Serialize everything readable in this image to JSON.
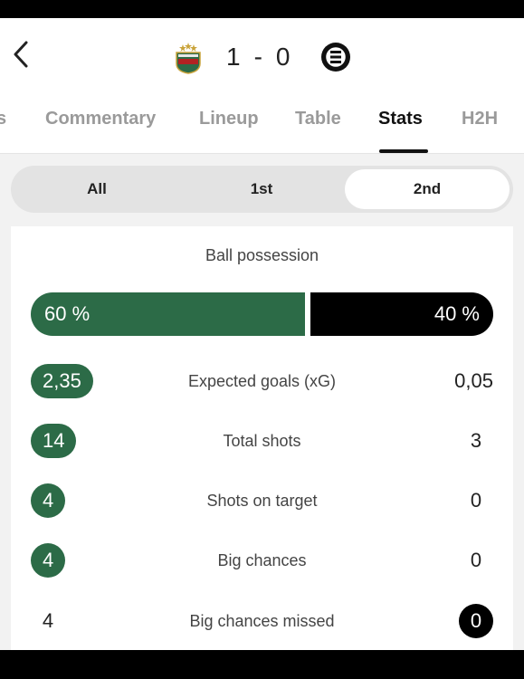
{
  "match": {
    "home_score": "1",
    "separator": "-",
    "away_score": "0"
  },
  "tabs": [
    {
      "label": "s"
    },
    {
      "label": "Commentary"
    },
    {
      "label": "Lineup"
    },
    {
      "label": "Table"
    },
    {
      "label": "Stats"
    },
    {
      "label": "H2H"
    }
  ],
  "active_tab": "Stats",
  "periods": [
    {
      "label": "All"
    },
    {
      "label": "1st"
    },
    {
      "label": "2nd"
    }
  ],
  "active_period": "2nd",
  "possession": {
    "title": "Ball possession",
    "home_label": "60 %",
    "away_label": "40 %",
    "home_percent": 60,
    "away_percent": 40
  },
  "stats": [
    {
      "label": "Expected goals (xG)",
      "home": "2,35",
      "away": "0,05",
      "highlight": "home"
    },
    {
      "label": "Total shots",
      "home": "14",
      "away": "3",
      "highlight": "home"
    },
    {
      "label": "Shots on target",
      "home": "4",
      "away": "0",
      "highlight": "home"
    },
    {
      "label": "Big chances",
      "home": "4",
      "away": "0",
      "highlight": "home"
    },
    {
      "label": "Big chances missed",
      "home": "4",
      "away": "0",
      "highlight": "away"
    }
  ],
  "colors": {
    "home_team": "#2c6b47",
    "away_team": "#000000",
    "inactive_tab": "#9a9a9a"
  },
  "icons": {
    "back": "chevron-left-icon",
    "home_crest": "home-team-crest",
    "away_crest": "away-team-crest"
  }
}
